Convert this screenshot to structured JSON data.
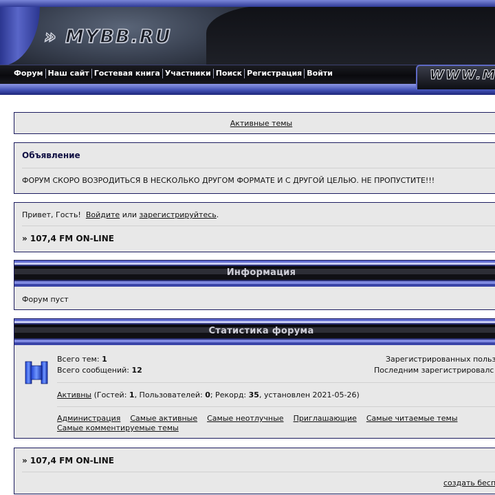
{
  "header": {
    "logo_text": "» MYBB.RU",
    "www_text": "WWW.MY",
    "nav": [
      "Форум",
      "Наш сайт",
      "Гостевая книга",
      "Участники",
      "Поиск",
      "Регистрация",
      "Войти"
    ]
  },
  "active_topics": {
    "label": "Активные темы"
  },
  "announcement": {
    "title": "Объявление",
    "text": "ФОРУМ СКОРО ВОЗРОДИТЬСЯ В НЕСКОЛЬКО ДРУГОМ ФОРМАТЕ И С ДРУГОЙ ЦЕЛЬЮ. НЕ ПРОПУСТИТЕ!!!"
  },
  "welcome": {
    "greeting": "Привет, Гость!",
    "login_link": "Войдите",
    "or_text": "или",
    "register_link": "зарегистрируйтесь",
    "period": ".",
    "radio": "» 107,4 FM ON-LINE"
  },
  "info": {
    "title": "Информация",
    "text": "Форум пуст"
  },
  "stats": {
    "title": "Статистика форума",
    "topics_label": "Всего тем:",
    "topics_value": "1",
    "posts_label": "Всего сообщений:",
    "posts_value": "12",
    "registered_text": "Зарегистрированных польз",
    "last_registered_text": "Последним зарегистрировалс",
    "active_link": "Активны",
    "online_guests_label": "(Гостей:",
    "online_guests": "1",
    "online_users_label": ", Пользователей:",
    "online_users": "0",
    "record_label": "; Рекорд:",
    "record": "35",
    "record_date": ", установлен 2021-05-26)",
    "links": [
      "Администрация",
      "Самые активные",
      "Самые неотлучные",
      "Приглашающие",
      "Самые читаемые темы",
      "Самые комментируемые темы"
    ]
  },
  "footer": {
    "radio": "» 107,4 FM ON-LINE",
    "create_link": "создать бесп"
  },
  "colors": {
    "accent_blue": "#4453b6",
    "panel_bg": "#e8e8e8",
    "panel_border": "#1a1a5e"
  }
}
